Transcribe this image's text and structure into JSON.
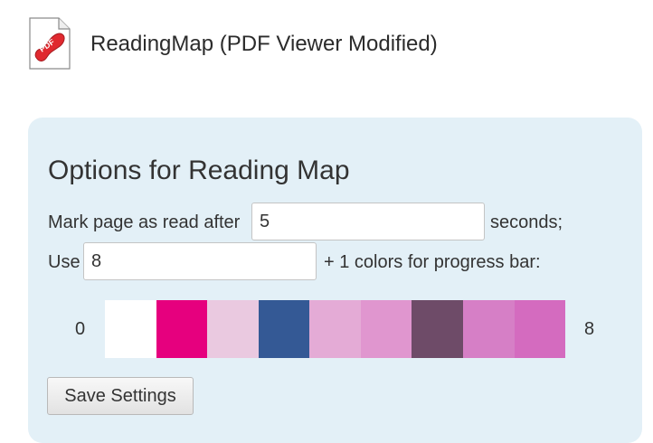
{
  "header": {
    "title": "ReadingMap (PDF Viewer Modified)",
    "icon": "pdf-file-icon",
    "icon_label": "PDF"
  },
  "options": {
    "heading": "Options for Reading Map",
    "mark_prefix": "Mark page as read after",
    "mark_value": "5",
    "mark_suffix": "seconds;",
    "use_prefix": "Use",
    "use_value": "8",
    "use_suffix": "+ 1 colors for progress bar:"
  },
  "progress": {
    "min_label": "0",
    "max_label": "8",
    "colors": [
      "#ffffff",
      "#e6007e",
      "#eac9e0",
      "#345995",
      "#e4abd6",
      "#e096cf",
      "#6e4b68",
      "#d67fc6",
      "#d46bbf"
    ]
  },
  "actions": {
    "save_label": "Save Settings"
  },
  "colors": {
    "panel_background": "#e3f0f7",
    "icon_red": "#e0292f"
  }
}
